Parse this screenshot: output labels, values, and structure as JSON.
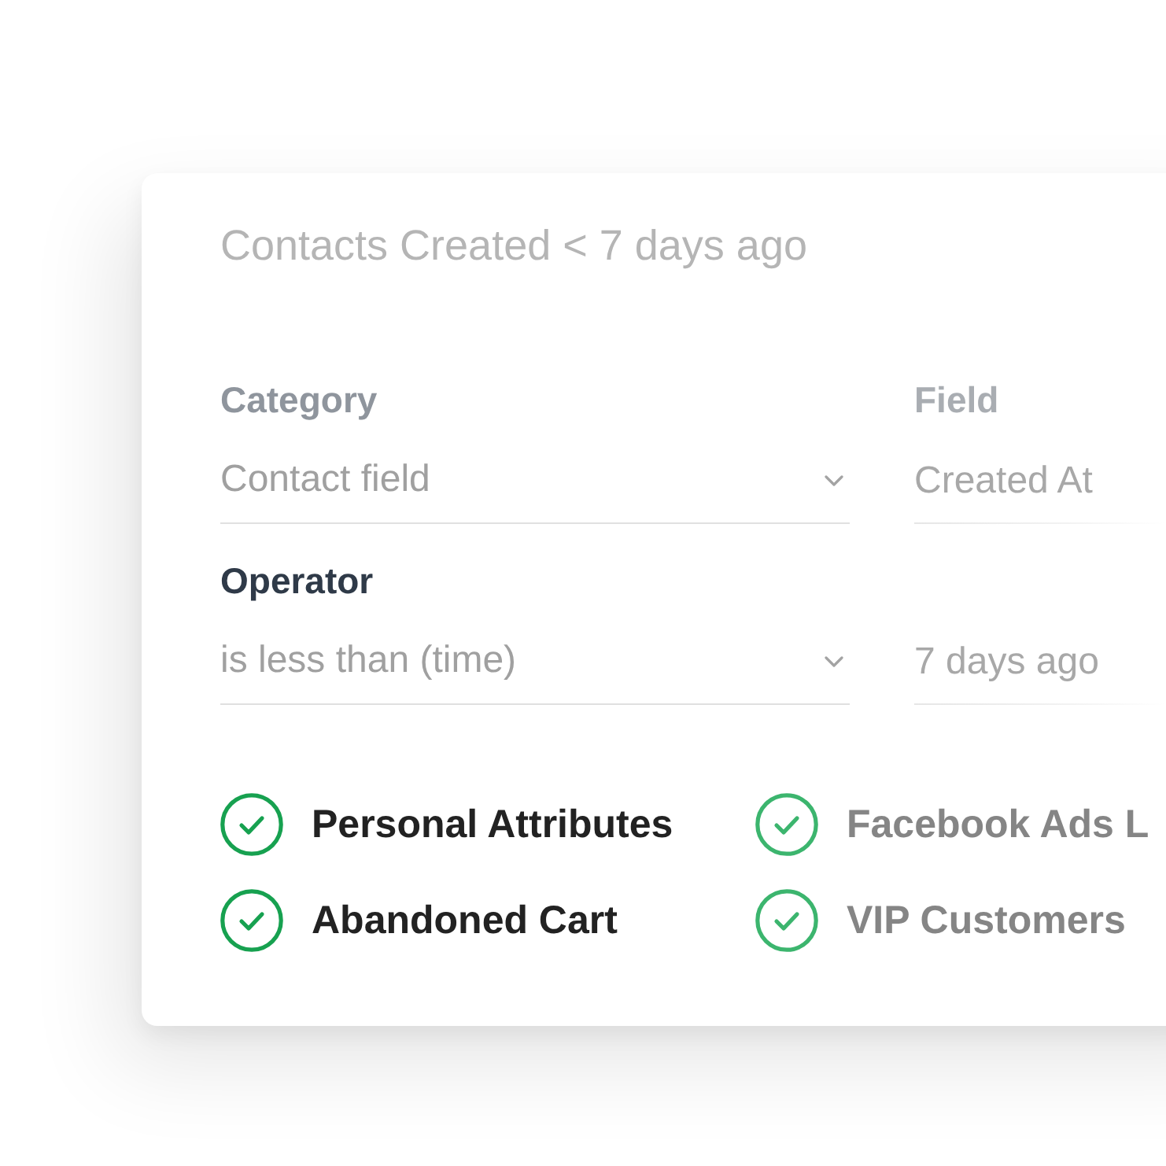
{
  "card": {
    "title": "Contacts Created < 7 days ago",
    "rows": [
      {
        "fields": [
          {
            "kind": "dropdown",
            "label": "Category",
            "value": "Contact field",
            "focused": false
          },
          {
            "kind": "text",
            "label": "Field",
            "value": "Created At",
            "focused": false
          }
        ]
      },
      {
        "fields": [
          {
            "kind": "dropdown",
            "label": "Operator",
            "value": "is less than (time)",
            "focused": true
          },
          {
            "kind": "text",
            "value": "7 days ago"
          }
        ]
      }
    ],
    "segments": [
      {
        "name": "Personal Attributes",
        "checked": true
      },
      {
        "name": "Facebook Ads L",
        "checked": true
      },
      {
        "name": "Abandoned Cart",
        "checked": true
      },
      {
        "name": "VIP Customers",
        "checked": true
      }
    ]
  }
}
